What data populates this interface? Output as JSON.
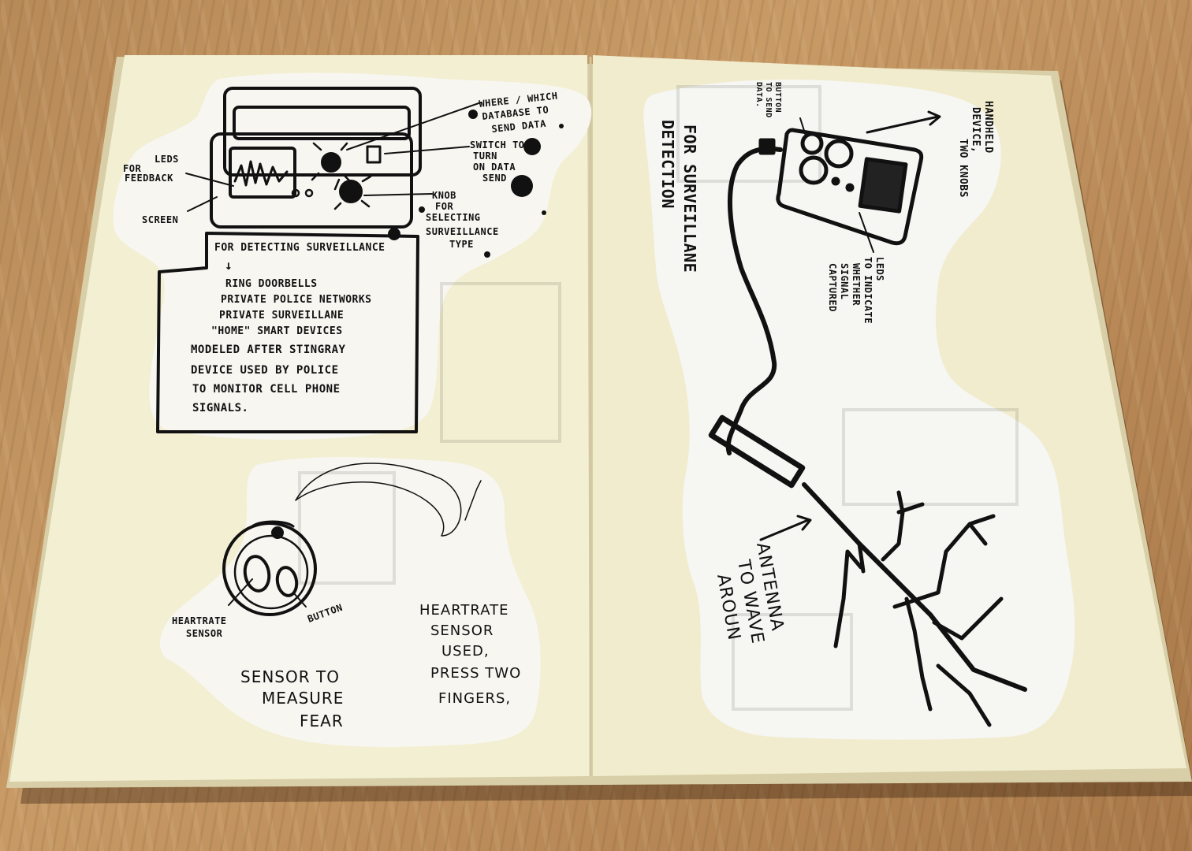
{
  "left_page": {
    "top_drawing": {
      "labels": {
        "database": [
          "WHERE / WHICH",
          "DATABASE TO",
          "SEND DATA"
        ],
        "switch": [
          "SWITCH TO",
          "TURN",
          "ON DATA",
          "SEND"
        ],
        "leds": [
          "LEDS",
          "FOR",
          "FEEDBACK"
        ],
        "screen": "SCREEN",
        "knob": [
          "KNOB",
          "FOR",
          "SELECTING",
          "SURVEILLANCE",
          "TYPE"
        ]
      },
      "box_notes": {
        "heading": "FOR DETECTING SURVEILLANCE",
        "arrow": "↓",
        "items": [
          "RING DOORBELLS",
          "PRIVATE POLICE NETWORKS",
          "PRIVATE SURVEILLANE",
          "\"HOME\" SMART DEVICES"
        ],
        "modeled": [
          "MODELED AFTER STINGRAY",
          "DEVICE USED BY POLICE",
          "TO MONITOR  CELL PHONE",
          "SIGNALS."
        ]
      }
    },
    "bottom_drawing": {
      "labels": {
        "heartrate_sensor": [
          "HEARTRATE",
          "SENSOR"
        ],
        "button": "BUTTON"
      },
      "caption_left": [
        "SENSOR TO",
        "MEASURE",
        "FEAR"
      ],
      "caption_right": [
        "HEARTRATE",
        "SENSOR",
        "USED,",
        "PRESS TWO",
        "FINGERS,"
      ]
    }
  },
  "right_page": {
    "title": [
      "FOR SURVEILLANE",
      "DETECTION"
    ],
    "labels": {
      "button": [
        "BUTTON",
        "TO SEND",
        "DATA."
      ],
      "handheld": [
        "HANDHELD",
        "DEVICE,",
        "TWO KNOBS"
      ],
      "leds": [
        "LEDS",
        "TO INDICATE",
        "WHETHER",
        "SIGNAL",
        "CAPTURED"
      ],
      "antenna": [
        "ANTENNA",
        "TO WAVE",
        "AROUN"
      ]
    }
  },
  "colors": {
    "table": "#b88a58",
    "paper": "#f4f0d4",
    "cutout": "#f6f6f2",
    "ink": "#111111"
  }
}
